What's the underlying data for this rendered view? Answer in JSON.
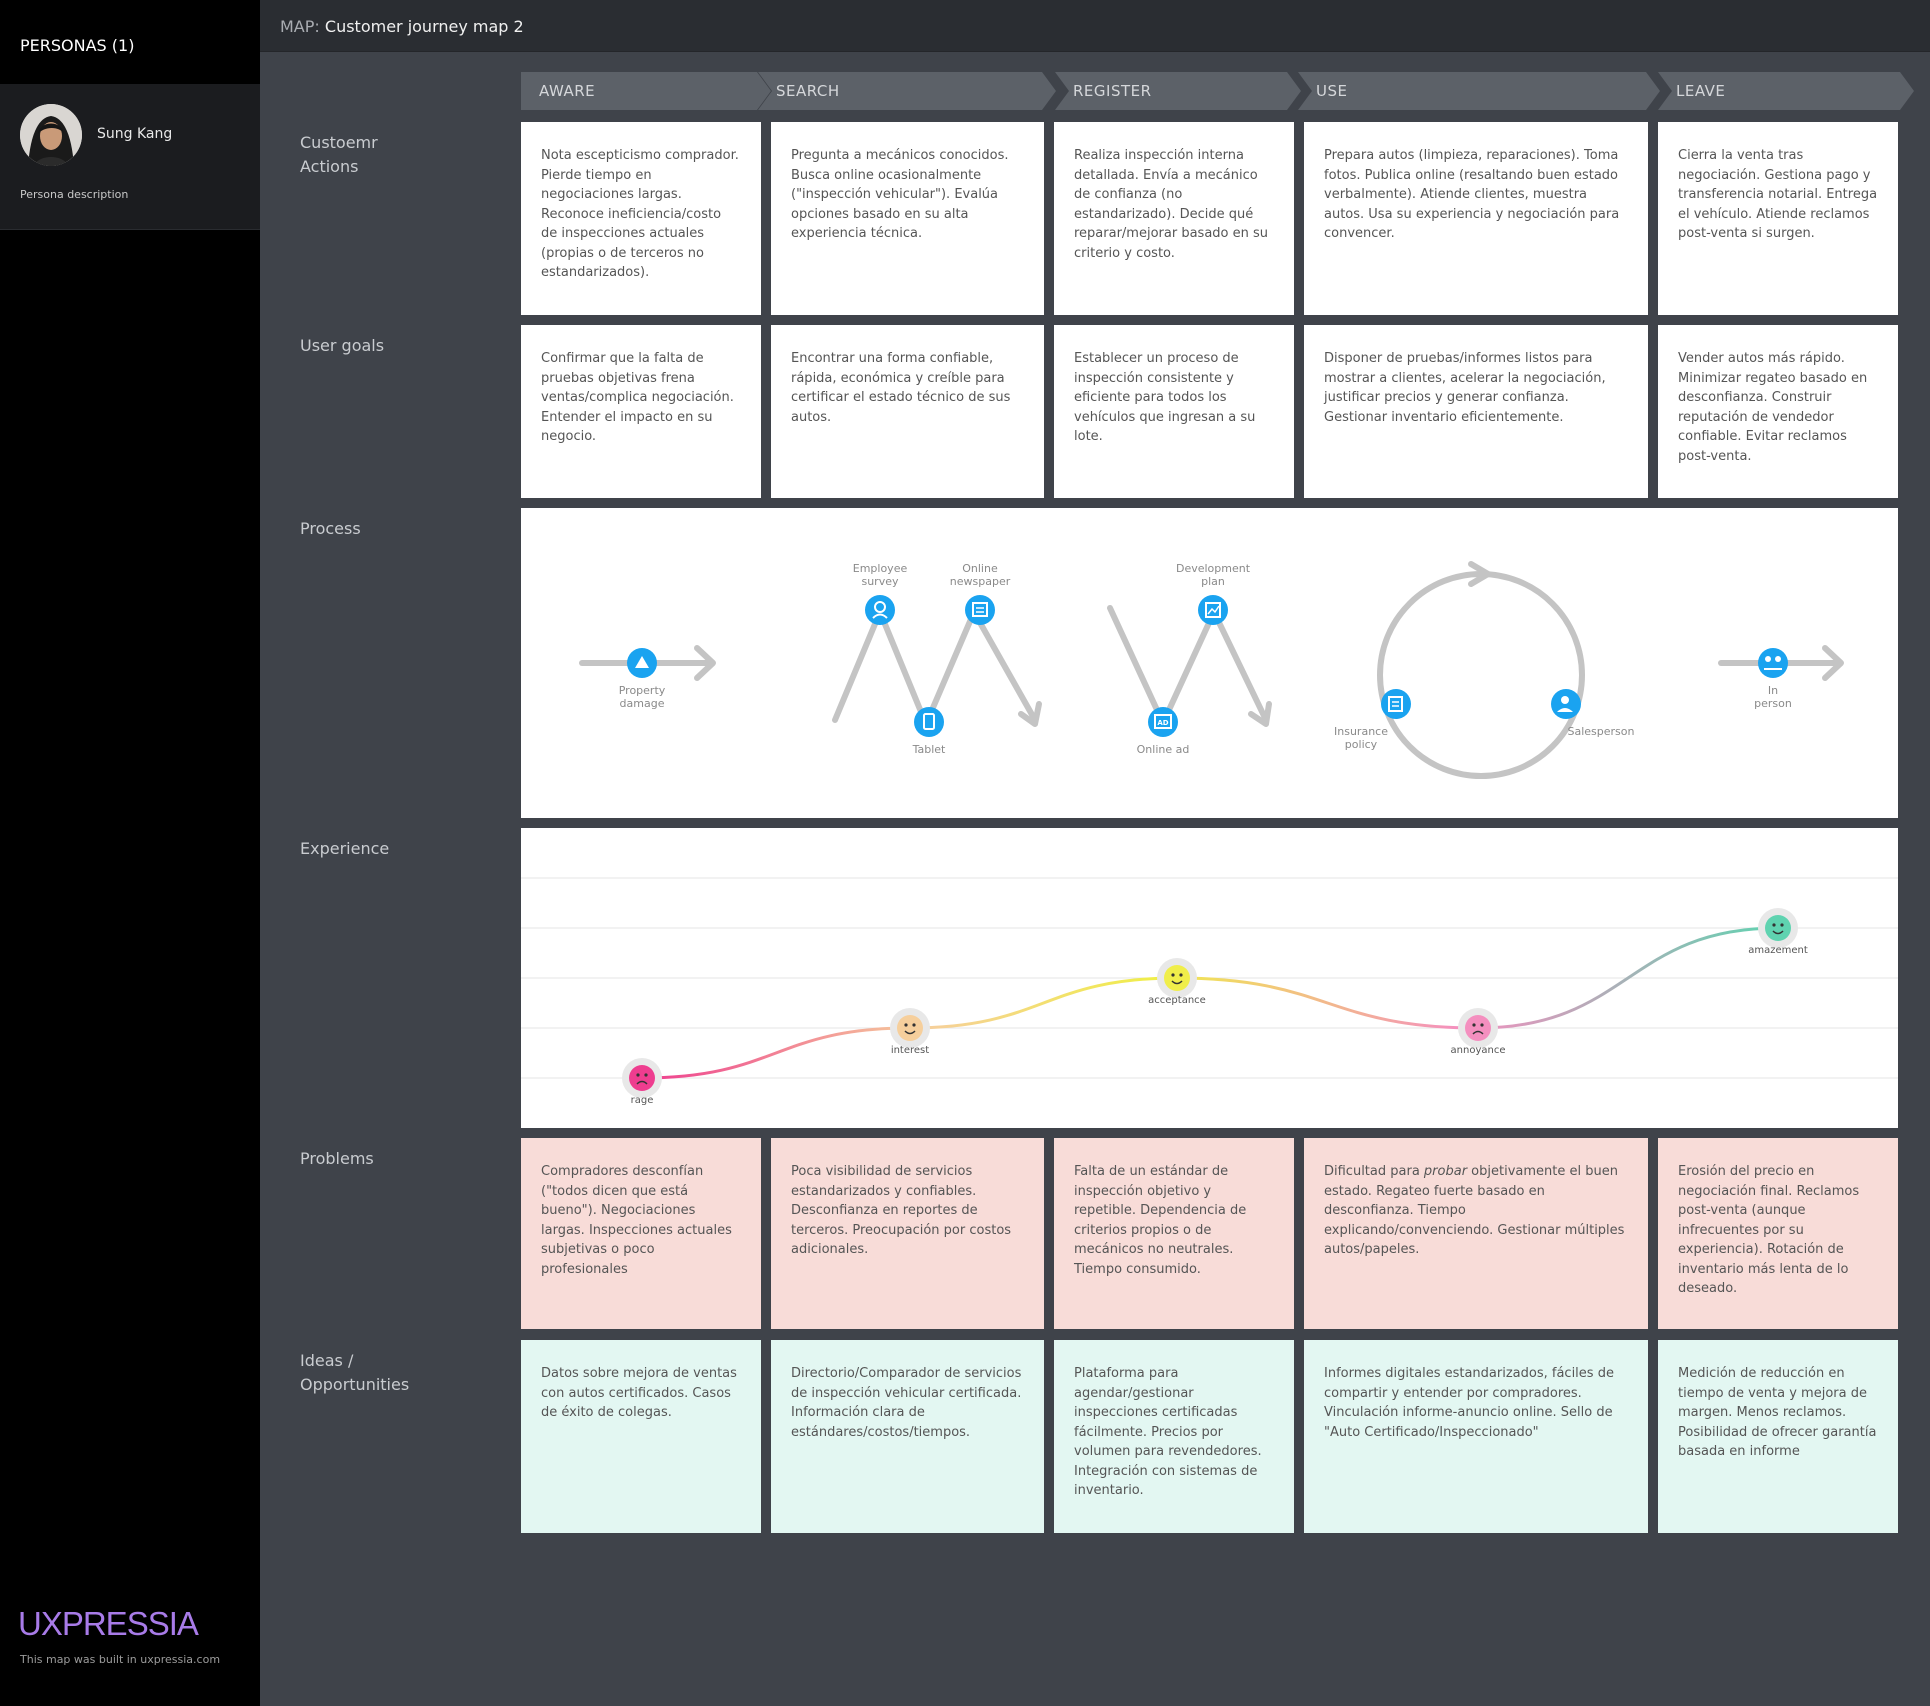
{
  "sidebar": {
    "personas_title": "PERSONAS (1)",
    "persona": {
      "name": "Sung Kang",
      "description": "Persona description"
    },
    "brand": "UXPRESSIA",
    "brand_note": "This map was built in uxpressia.com"
  },
  "topbar": {
    "prefix": "MAP:",
    "title": "Customer journey map 2"
  },
  "stages": [
    "AWARE",
    "SEARCH",
    "REGISTER",
    "USE",
    "LEAVE"
  ],
  "rows": {
    "actions": {
      "label": "Custoemr Actions",
      "cells": [
        "Nota escepticismo comprador. Pierde tiempo en negociaciones largas. Reconoce ineficiencia/costo de inspecciones actuales (propias o de terceros no estandarizados).",
        "Pregunta a mecánicos conocidos. Busca online ocasionalmente (\"inspección vehicular\"). Evalúa opciones basado en su alta experiencia técnica.",
        "Realiza inspección interna detallada. Envía a mecánico de confianza (no estandarizado). Decide qué reparar/mejorar basado en su criterio y costo.",
        "Prepara autos (limpieza, reparaciones). Toma fotos. Publica online (resaltando buen estado verbalmente). Atiende clientes, muestra autos. Usa su experiencia y negociación para convencer.",
        "Cierra la venta tras negociación. Gestiona pago y transferencia notarial. Entrega el vehículo. Atiende reclamos post-venta si surgen."
      ]
    },
    "goals": {
      "label": "User goals",
      "cells": [
        "Confirmar que la falta de pruebas objetivas frena ventas/complica negociación. Entender el impacto en su negocio.",
        "Encontrar una forma confiable, rápida, económica y creíble para certificar el estado técnico de sus autos.",
        "Establecer un proceso de inspección consistente y eficiente para todos los vehículos que ingresan a su lote.",
        "Disponer de pruebas/informes listos para mostrar a clientes, acelerar la negociación, justificar precios y generar confianza. Gestionar inventario eficientemente.",
        "Vender autos más rápido. Minimizar regateo basado en desconfianza. Construir reputación de vendedor confiable. Evitar reclamos post-venta."
      ]
    },
    "process": {
      "label": "Process",
      "items": [
        {
          "label": "Property damage",
          "icon": "property-damage-icon"
        },
        {
          "label": "Employee survey",
          "icon": "employee-survey-icon"
        },
        {
          "label": "Online newspaper",
          "icon": "online-newspaper-icon"
        },
        {
          "label": "Tablet",
          "icon": "tablet-icon"
        },
        {
          "label": "Development plan",
          "icon": "development-plan-icon"
        },
        {
          "label": "Online ad",
          "icon": "online-ad-icon"
        },
        {
          "label": "Insurance policy",
          "icon": "insurance-policy-icon"
        },
        {
          "label": "Salesperson",
          "icon": "salesperson-icon"
        },
        {
          "label": "In person",
          "icon": "in-person-icon"
        }
      ]
    },
    "experience": {
      "label": "Experience",
      "points": [
        {
          "emotion": "rage",
          "level": 1,
          "color": "#ee3d8f"
        },
        {
          "emotion": "interest",
          "level": 2,
          "color": "#f6cf9c"
        },
        {
          "emotion": "acceptance",
          "level": 3,
          "color": "#f0ee4a"
        },
        {
          "emotion": "annoyance",
          "level": 2,
          "color": "#f48fbf"
        },
        {
          "emotion": "amazement",
          "level": 4,
          "color": "#5fd3b0"
        }
      ]
    },
    "problems": {
      "label": "Problems",
      "cells": [
        "Compradores desconfían (\"todos dicen que está bueno\"). Negociaciones largas. Inspecciones actuales subjetivas o poco profesionales",
        "Poca visibilidad de servicios estandarizados y confiables. Desconfianza en reportes de terceros. Preocupación por costos adicionales.",
        "Falta de un estándar de inspección objetivo y repetible. Dependencia de criterios propios o de mecánicos no neutrales. Tiempo consumido.",
        {
          "before": "Dificultad para ",
          "em": "probar",
          "after": " objetivamente el buen estado. Regateo fuerte basado en desconfianza. Tiempo explicando/convenciendo. Gestionar múltiples autos/papeles."
        },
        "Erosión del precio en negociación final. Reclamos post-venta (aunque infrecuentes por su experiencia). Rotación de inventario más lenta de lo deseado."
      ]
    },
    "ideas": {
      "label": "Ideas / Opportunities",
      "cells": [
        "Datos sobre mejora de ventas con autos certificados. Casos de éxito de colegas.",
        "Directorio/Comparador de servicios de inspección vehicular certificada. Información clara de estándares/costos/tiempos.",
        "Plataforma para agendar/gestionar inspecciones certificadas fácilmente. Precios por volumen para revendedores. Integración con sistemas de inventario.",
        "Informes digitales estandarizados, fáciles de compartir y entender por compradores. Vinculación informe-anuncio online. Sello de \"Auto Certificado/Inspeccionado\"",
        "Medición de reducción en tiempo de venta y mejora de margen. Menos reclamos. Posibilidad de ofrecer garantía basada en informe"
      ]
    }
  },
  "colors": {
    "icon_blue": "#1aa3f0",
    "sidebar": "#000000",
    "canvas": "#3f434a",
    "stage": "#5c6168",
    "brand": "#a87be8"
  }
}
